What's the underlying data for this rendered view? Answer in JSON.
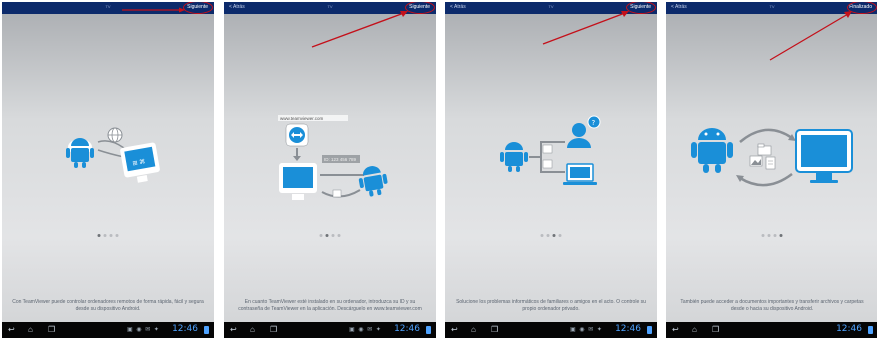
{
  "panels": [
    {
      "topbar": {
        "back": "",
        "center": "TV",
        "next": "Siguiente"
      },
      "caption": "Con TeamViewer puede controlar ordenadores remotos de forma rápida, fácil y segura desde su dispositivo Android.",
      "active_dot": 0
    },
    {
      "topbar": {
        "back": "< Atrás",
        "center": "TV",
        "next": "Siguiente"
      },
      "caption": "En cuanto TeamViewer esté instalado en su ordenador, introduzca su ID y su contraseña de TeamViewer en la aplicación. Descárguelo en www.teamviewer.com",
      "url_label": "www.teamviewer.com",
      "id_label": "ID: 123 456 789",
      "active_dot": 1
    },
    {
      "topbar": {
        "back": "< Atrás",
        "center": "TV",
        "next": "Siguiente"
      },
      "caption": "Solucione los problemas informáticos de familiares o amigos en el acto. O controle su propio ordenador privado.",
      "active_dot": 2
    },
    {
      "topbar": {
        "back": "< Atrás",
        "center": "TV",
        "next": "Finalizado"
      },
      "caption": "También puede acceder a documentos importantes y transferir archivos y carpetas desde o hacia su dispositivo Android.",
      "active_dot": 3
    }
  ],
  "navbar": {
    "clock": "12:46"
  },
  "colors": {
    "topbar": "#0c2a6b",
    "accent": "#1a8fd8",
    "annotation": "#c4101a"
  }
}
